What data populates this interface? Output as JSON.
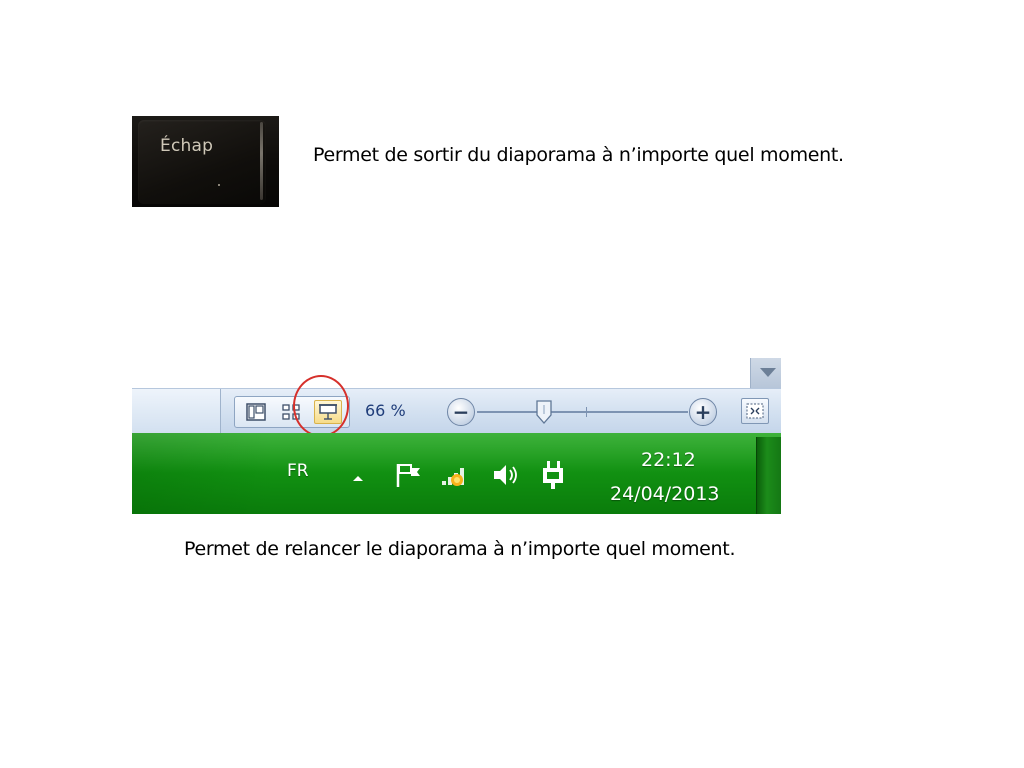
{
  "esc_key": {
    "label": "Échap"
  },
  "captions": {
    "esc": "Permet de sortir du diaporama à n’importe quel moment.",
    "slideshow": "Permet de relancer le diaporama à n’importe quel moment."
  },
  "statusbar": {
    "zoom_percent": "66 %",
    "zoom_out_symbol": "−",
    "zoom_in_symbol": "+",
    "view_buttons": [
      {
        "name": "normal-view",
        "icon": "normal-view-icon"
      },
      {
        "name": "slide-sorter-view",
        "icon": "slide-sorter-icon"
      },
      {
        "name": "slideshow-view",
        "icon": "slideshow-icon",
        "highlighted": true
      }
    ]
  },
  "taskbar": {
    "language": "FR",
    "clock": {
      "time": "22:12",
      "date": "24/04/2013"
    },
    "tray_icons": [
      "show-hidden-icons-arrow-icon",
      "action-center-flag-icon",
      "network-signal-icon",
      "volume-icon",
      "power-plug-icon"
    ]
  },
  "colors": {
    "highlight_circle": "#d6302b",
    "taskbar_green": "#129212",
    "zoom_text": "#1f3d7a"
  }
}
